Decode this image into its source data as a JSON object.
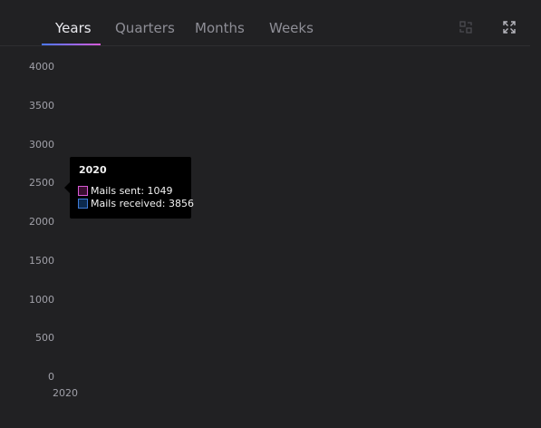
{
  "tabs": [
    {
      "label": "Years",
      "active": true
    },
    {
      "label": "Quarters",
      "active": false
    },
    {
      "label": "Months",
      "active": false
    },
    {
      "label": "Weeks",
      "active": false
    }
  ],
  "toolbar": {
    "swap_icon": "swap-axes-icon",
    "expand_icon": "expand-icon"
  },
  "colors": {
    "background": "#212123",
    "mails_sent": "#d75ad6",
    "mails_received": "#3f7bd8",
    "tab_underline_start": "#4a78ff",
    "tab_underline_end": "#d75ad6"
  },
  "chart_data": {
    "type": "bar",
    "categories": [
      "2020"
    ],
    "series": [
      {
        "name": "Mails sent",
        "values": [
          1049
        ]
      },
      {
        "name": "Mails received",
        "values": [
          3856
        ]
      }
    ],
    "yticks": [
      "4000",
      "3500",
      "3000",
      "2500",
      "2000",
      "1500",
      "1000",
      "500",
      "0"
    ],
    "ylim": [
      0,
      4000
    ],
    "grid": false
  },
  "tooltip": {
    "title": "2020",
    "rows": [
      {
        "text": "Mails sent: 1049"
      },
      {
        "text": "Mails received: 3856"
      }
    ]
  }
}
